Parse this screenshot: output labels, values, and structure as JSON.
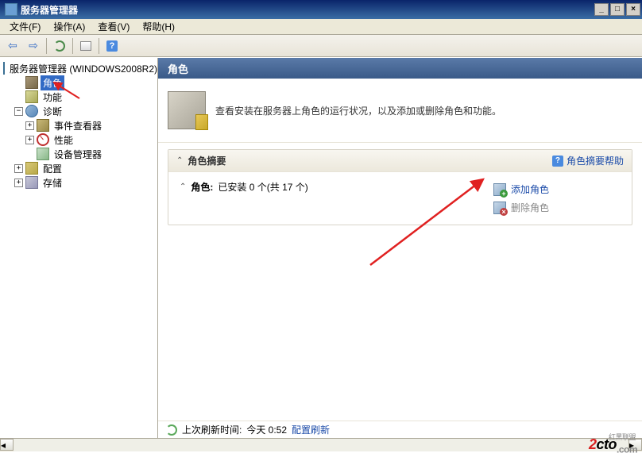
{
  "titlebar": {
    "title": "服务器管理器"
  },
  "menu": {
    "file": "文件(F)",
    "action": "操作(A)",
    "view": "查看(V)",
    "help": "帮助(H)"
  },
  "tree": {
    "root": "服务器管理器 (WINDOWS2008R2)",
    "roles": "角色",
    "features": "功能",
    "diagnostics": "诊断",
    "event_viewer": "事件查看器",
    "performance": "性能",
    "device_mgr": "设备管理器",
    "config": "配置",
    "storage": "存储"
  },
  "content": {
    "header": "角色",
    "description": "查看安装在服务器上角色的运行状况，以及添加或删除角色和功能。",
    "summary_title": "角色摘要",
    "summary_help": "角色摘要帮助",
    "roles_label": "角色:",
    "roles_status": "已安装 0 个(共 17 个)",
    "add_roles": "添加角色",
    "remove_roles": "删除角色"
  },
  "status": {
    "prefix": "上次刷新时间:",
    "time": "今天 0:52",
    "config_refresh": "配置刷新"
  },
  "watermark": {
    "part1": "2",
    "part2": "cto",
    "part3": ".com",
    "part4": "红黑联盟"
  }
}
